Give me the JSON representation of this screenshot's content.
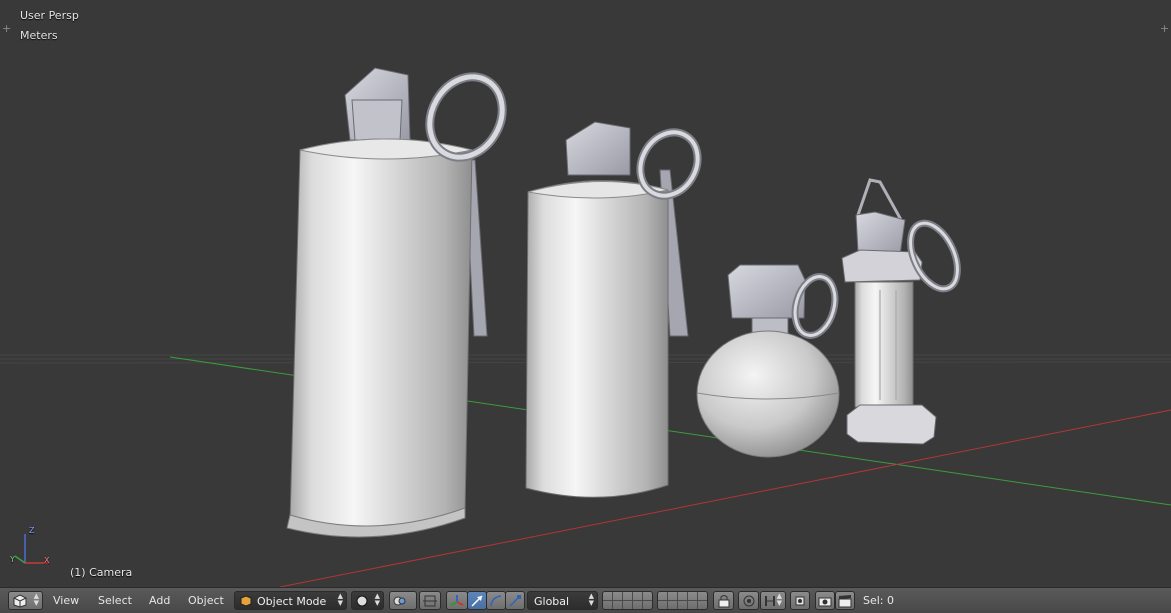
{
  "viewport": {
    "view_name": "User Persp",
    "units": "Meters",
    "object_label": "(1) Camera",
    "axis_z": "Z",
    "axis_y": "Y",
    "axis_x": "X"
  },
  "header": {
    "menus": [
      "View",
      "Select",
      "Add",
      "Object"
    ],
    "mode": "Object Mode",
    "orientation": "Global",
    "selection": "Sel: 0"
  },
  "icons": {
    "editor_type": "cube-icon",
    "shading": "solid-sphere-icon",
    "pivot": "pivot-icon",
    "manipulator": "manipulator-axes-icon",
    "translate": "translate-arrow-icon",
    "rotate": "rotate-arc-icon",
    "scale": "scale-icon",
    "layers": "layers-grid-icon",
    "lock": "lock-camera-icon",
    "proportional": "proportional-edit-icon",
    "snap": "snap-magnet-icon",
    "render": "render-camera-icon",
    "clapper": "clapperboard-icon"
  },
  "colors": {
    "viewport_bg": "#393939",
    "x_axis": "#b23636",
    "y_axis": "#3b9d3b",
    "header_bg": "#4f4f4f",
    "active_tool": "#5680c2"
  }
}
